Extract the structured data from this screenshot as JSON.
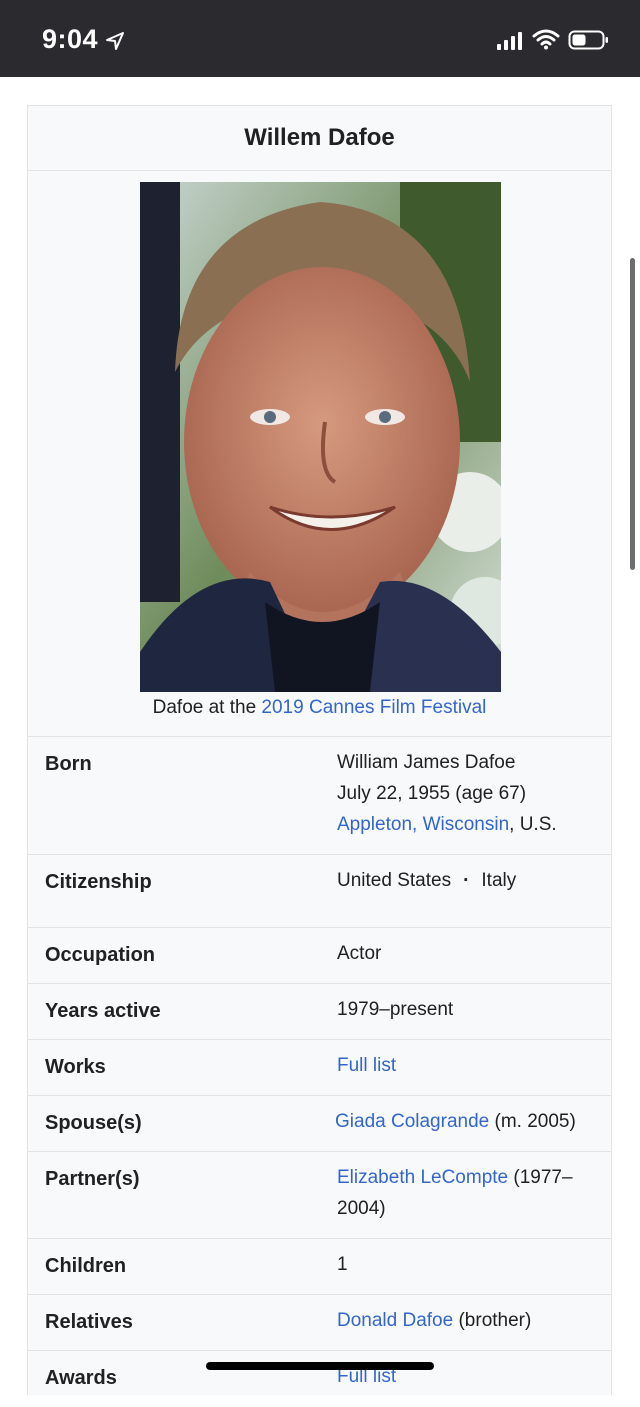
{
  "status_bar": {
    "time": "9:04",
    "icons": [
      "location-arrow-icon",
      "signal-bars-icon",
      "wifi-icon",
      "battery-icon"
    ]
  },
  "infobox": {
    "title": "Willem Dafoe",
    "image_alt": "Portrait of Willem Dafoe smiling",
    "caption_prefix": "Dafoe at the ",
    "caption_link": "2019 Cannes Film Festival",
    "rows": {
      "born": {
        "label": "Born",
        "name": "William James Dafoe",
        "date": "July 22, 1955 (age 67)",
        "place_link": "Appleton, Wisconsin",
        "place_suffix": ", U.S."
      },
      "citizenship": {
        "label": "Citizenship",
        "value1": "United States",
        "separator": "·",
        "value2": "Italy"
      },
      "occupation": {
        "label": "Occupation",
        "value": "Actor"
      },
      "years_active": {
        "label": "Years active",
        "value": "1979–present"
      },
      "works": {
        "label": "Works",
        "link": "Full list"
      },
      "spouse": {
        "label": "Spouse(s)",
        "link": "Giada Colagrande",
        "suffix": " (m. 2005)"
      },
      "partner": {
        "label": "Partner(s)",
        "link": "Elizabeth LeCompte",
        "suffix": " (1977–",
        "line2": "2004)"
      },
      "children": {
        "label": "Children",
        "value": "1"
      },
      "relatives": {
        "label": "Relatives",
        "link": "Donald Dafoe",
        "suffix": " (brother)"
      },
      "awards": {
        "label": "Awards",
        "link": "Full list"
      }
    }
  },
  "colors": {
    "link": "#3366cc",
    "status_bar_bg": "#2b2b2f",
    "infobox_bg": "#f8f9fa",
    "border": "#e2e3e5"
  }
}
